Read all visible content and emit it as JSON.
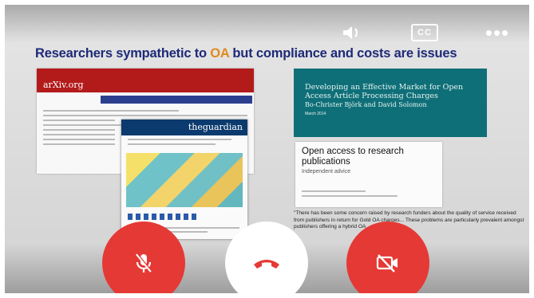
{
  "slide": {
    "title_part1": "Researchers sympathetic to ",
    "title_highlight": "OA",
    "title_part2": " but compliance and costs are issues",
    "arxiv_logo": "arXiv.org",
    "guardian_masthead": "theguardian",
    "report_title": "Developing an Effective Market for Open Access Article Processing Charges",
    "report_authors": "Bo-Christer Björk and David Solomon",
    "report_date": "March 2014",
    "advice_title": "Open access to research publications",
    "advice_subtitle": "Independent advice",
    "quote": "\"There has been some concern raised by research funders about the quality of service received from publishers in return for Gold OA charges... These problems are particularly prevalent amongst publishers offering a hybrid OA..."
  },
  "controls": {
    "cc_label": "CC",
    "more_label": "•••"
  },
  "call_buttons": {
    "mute": "mic-off",
    "end": "end-call",
    "video": "video-off"
  },
  "colors": {
    "title": "#1e2a78",
    "highlight": "#e08a1e",
    "button_red": "#e53935",
    "end_icon": "#e53935"
  }
}
